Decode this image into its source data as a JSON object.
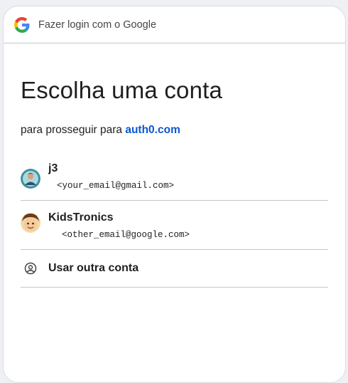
{
  "header": {
    "title": "Fazer login com o Google",
    "logo_icon": "google-g-logo-icon"
  },
  "main": {
    "title": "Escolha uma conta",
    "subtitle_prefix": "para prosseguir para",
    "app_link": "auth0.com"
  },
  "accounts": [
    {
      "name": "j3",
      "email": "<your_email@gmail.com>",
      "avatar_icon": "avatar-illustration-icon"
    },
    {
      "name": "KidsTronics",
      "email": "<other_email@google.com>",
      "avatar_icon": "avatar-cartoon-face-icon"
    }
  ],
  "other_account": {
    "label": "Usar outra conta",
    "icon": "account-circle-icon"
  },
  "colors": {
    "link": "#0b57d0",
    "divider": "#c4c7c5",
    "text": "#1f1f1f"
  }
}
